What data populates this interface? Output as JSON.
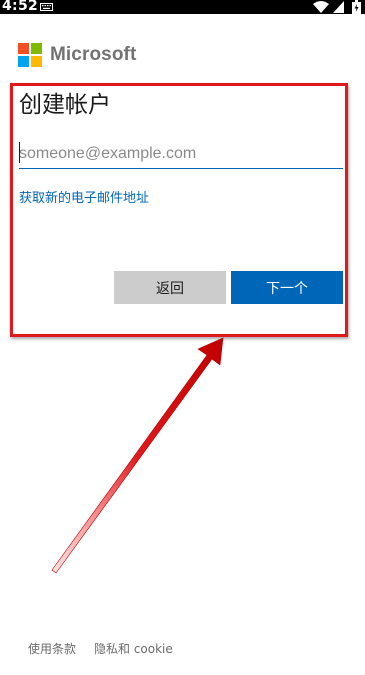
{
  "status_bar": {
    "time": "4:52",
    "icons": [
      "keyboard-icon",
      "wifi-icon",
      "signal-icon",
      "battery-icon"
    ]
  },
  "logo": {
    "text": "Microsoft",
    "colors": [
      "#f25022",
      "#7fba00",
      "#00a4ef",
      "#ffb900"
    ]
  },
  "form": {
    "title": "创建帐户",
    "email_placeholder": "someone@example.com",
    "email_value": "",
    "new_email_link": "获取新的电子邮件地址",
    "back_label": "返回",
    "next_label": "下一个"
  },
  "footer": {
    "terms_label": "使用条款",
    "privacy_label": "隐私和 cookie"
  },
  "colors": {
    "accent": "#0067b8",
    "annotation": "#e0191d",
    "back_button": "#cccccc"
  }
}
